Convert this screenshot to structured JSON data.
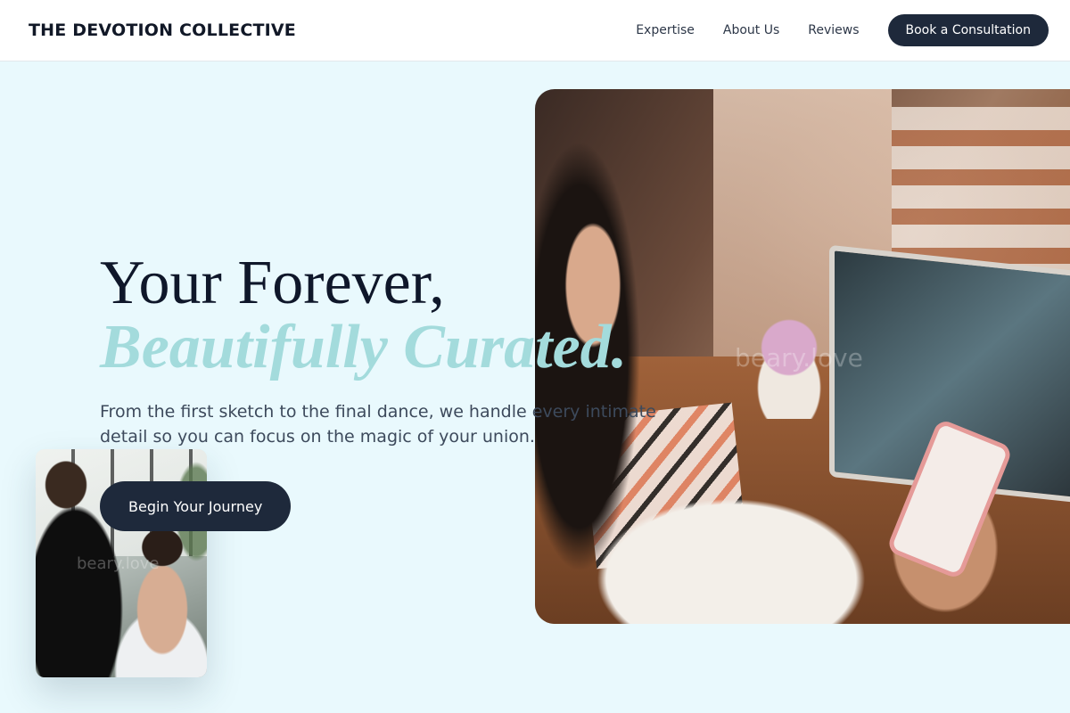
{
  "header": {
    "brand": "THE DEVOTION COLLECTIVE",
    "nav": [
      {
        "label": "Expertise"
      },
      {
        "label": "About Us"
      },
      {
        "label": "Reviews"
      }
    ],
    "cta_label": "Book a Consultation"
  },
  "hero": {
    "title_line1": "Your Forever,",
    "title_line2": "Beautifully Curated.",
    "subtitle": "From the first sketch to the final dance, we handle every intimate detail so you can focus on the magic of your union.",
    "cta_label": "Begin Your Journey"
  },
  "images": {
    "main_watermark": "beary.love",
    "small_watermark": "beary.love"
  },
  "colors": {
    "background": "#e9f9fd",
    "primary": "#1e293b",
    "accent": "#a3dbdc"
  }
}
